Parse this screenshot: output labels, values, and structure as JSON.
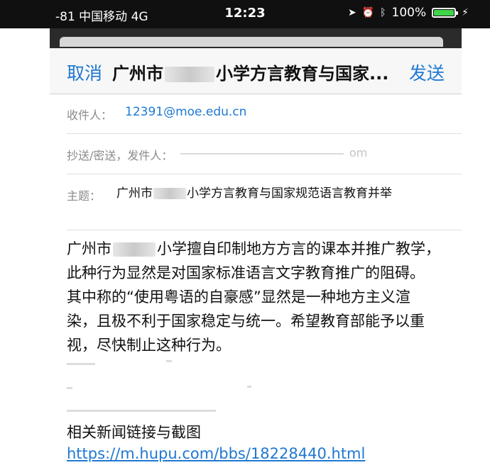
{
  "status_bar": {
    "carrier": "-81 中国移动  4G",
    "time": "12:23",
    "battery_pct": "100%",
    "icons": [
      "location-icon",
      "alarm-icon",
      "bluetooth-icon",
      "battery-icon",
      "charging-icon"
    ]
  },
  "nav": {
    "cancel_label": "取消",
    "title_prefix": "广州市",
    "title_suffix": "小学方言教育与国家...",
    "send_label": "发送"
  },
  "fields": {
    "to_label": "收件人：",
    "to_value": "12391@moe.edu.cn",
    "cc_label": "抄送/密送，发件人：",
    "cc_tail": "om",
    "subject_label": "主题：",
    "subject_prefix": "广州市",
    "subject_suffix": "小学方言教育与国家规范语言教育并举"
  },
  "body": {
    "line1_prefix": "广州市",
    "line1_suffix": "小学擅自印制地方方言的课本并推广教学，",
    "line2": "此种行为显然是对国家标准语言文字教育推广的阻碍。",
    "line3": "其中称的“使用粤语的自豪感”显然是一种地方主义渲",
    "line4": "染，且极不利于国家稳定与统一。希望教育部能予以重",
    "line5": "视，尽快制止这种行为。",
    "news_label": "相关新闻链接与截图",
    "link": "https://m.hupu.com/bbs/18228440.html"
  },
  "colors": {
    "accent": "#1f78d1",
    "status_bar_bg": "#101010",
    "battery": "#41d44a"
  }
}
